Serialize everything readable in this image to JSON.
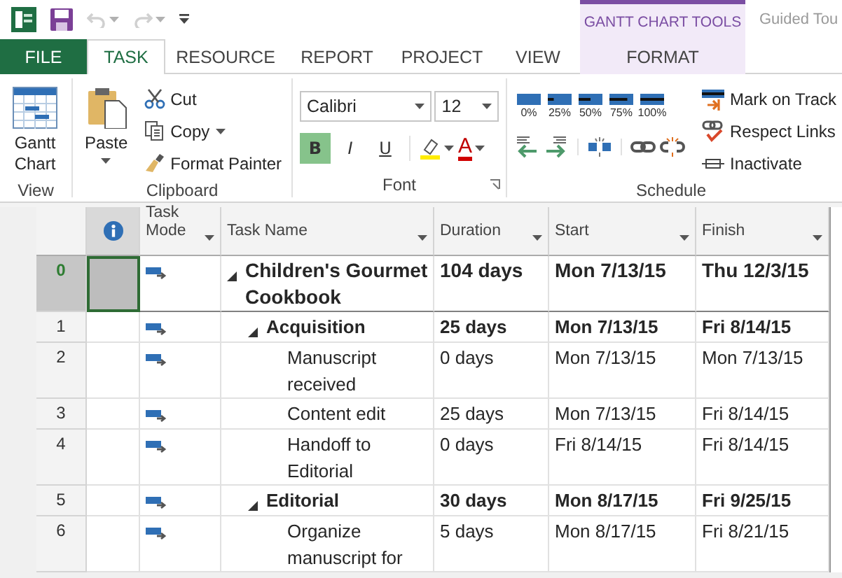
{
  "quick_access": [
    {
      "kind": "app"
    },
    {
      "kind": "save"
    },
    {
      "kind": "undo",
      "disabled": true
    },
    {
      "kind": "redo",
      "disabled": true
    },
    {
      "kind": "customize"
    }
  ],
  "contextual_group": {
    "title": "GANTT CHART TOOLS"
  },
  "guided_tour": "Guided Tou",
  "tabs": [
    {
      "label": "FILE",
      "kind": "file",
      "selected": false
    },
    {
      "label": "TASK",
      "kind": "normal",
      "selected": true
    },
    {
      "label": "RESOURCE",
      "kind": "normal",
      "selected": false
    },
    {
      "label": "REPORT",
      "kind": "normal",
      "selected": false
    },
    {
      "label": "PROJECT",
      "kind": "normal",
      "selected": false
    },
    {
      "label": "VIEW",
      "kind": "normal",
      "selected": false
    },
    {
      "label": "FORMAT",
      "kind": "contextual",
      "selected": false
    }
  ],
  "ribbon": {
    "view": {
      "label": "View",
      "button": "Gantt Chart"
    },
    "clipboard": {
      "label": "Clipboard",
      "paste": "Paste",
      "cut": "Cut",
      "copy": "Copy",
      "format_painter": "Format Painter"
    },
    "font": {
      "label": "Font",
      "family": "Calibri",
      "size": "12",
      "bold": {
        "label": "B",
        "on": true
      },
      "italic": {
        "label": "I",
        "on": false
      },
      "underline": {
        "label": "U",
        "on": false
      },
      "font_color": "A"
    },
    "schedule": {
      "label": "Schedule",
      "percent_buttons": [
        "0%",
        "25%",
        "50%",
        "75%",
        "100%"
      ],
      "mark_on_track": "Mark on Track",
      "respect_links": "Respect Links",
      "inactivate": "Inactivate"
    }
  },
  "table": {
    "columns": [
      {
        "kind": "info"
      },
      {
        "kind": "text",
        "label": "Task Mode"
      },
      {
        "kind": "text",
        "label": "Task Name"
      },
      {
        "kind": "text",
        "label": "Duration"
      },
      {
        "kind": "text",
        "label": "Start"
      },
      {
        "kind": "text",
        "label": "Finish"
      }
    ],
    "tasks": [
      {
        "id": "0",
        "name": "Children's Gourmet Cookbook",
        "duration": "104 days",
        "start": "Mon 7/13/15",
        "finish": "Thu 12/3/15",
        "selected": true,
        "expanded": true,
        "children": [
          {
            "id": "1",
            "name": "Acquisition",
            "duration": "25 days",
            "start": "Mon 7/13/15",
            "finish": "Fri 8/14/15",
            "selected": false,
            "expanded": true,
            "children": [
              {
                "id": "2",
                "name": "Manuscript received",
                "duration": "0 days",
                "start": "Mon 7/13/15",
                "finish": "Mon 7/13/15",
                "selected": false
              },
              {
                "id": "3",
                "name": "Content edit",
                "duration": "25 days",
                "start": "Mon 7/13/15",
                "finish": "Fri 8/14/15",
                "selected": false
              },
              {
                "id": "4",
                "name": "Handoff to Editorial",
                "duration": "0 days",
                "start": "Fri 8/14/15",
                "finish": "Fri 8/14/15",
                "selected": false
              }
            ]
          },
          {
            "id": "5",
            "name": "Editorial",
            "duration": "30 days",
            "start": "Mon 8/17/15",
            "finish": "Fri 9/25/15",
            "selected": false,
            "expanded": true,
            "children": [
              {
                "id": "6",
                "name": "Organize manuscript for",
                "duration": "5 days",
                "start": "Mon 8/17/15",
                "finish": "Fri 8/21/15",
                "selected": false
              }
            ]
          }
        ]
      }
    ]
  }
}
